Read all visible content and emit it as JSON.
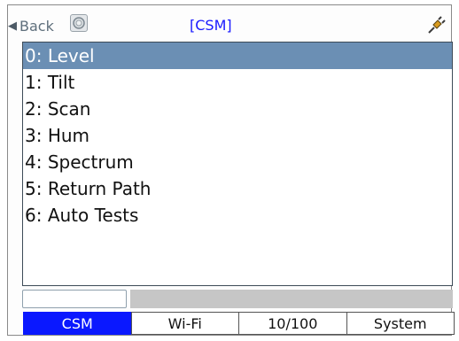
{
  "header": {
    "back_label": "Back",
    "title": "[CSM]"
  },
  "menu": {
    "items": [
      {
        "label": "0: Level",
        "selected": true
      },
      {
        "label": "1: Tilt"
      },
      {
        "label": "2: Scan"
      },
      {
        "label": "3: Hum"
      },
      {
        "label": "4: Spectrum"
      },
      {
        "label": "5: Return Path"
      },
      {
        "label": "6: Auto Tests"
      }
    ]
  },
  "tabs": [
    {
      "label": "CSM",
      "active": true
    },
    {
      "label": "Wi-Fi"
    },
    {
      "label": "10/100"
    },
    {
      "label": "System"
    }
  ],
  "colors": {
    "selection": "#6b8fb4",
    "active_tab": "#0a18ff",
    "title": "#1a1aff"
  },
  "icons": [
    "back-arrow-icon",
    "refresh-icon",
    "plug-icon"
  ]
}
